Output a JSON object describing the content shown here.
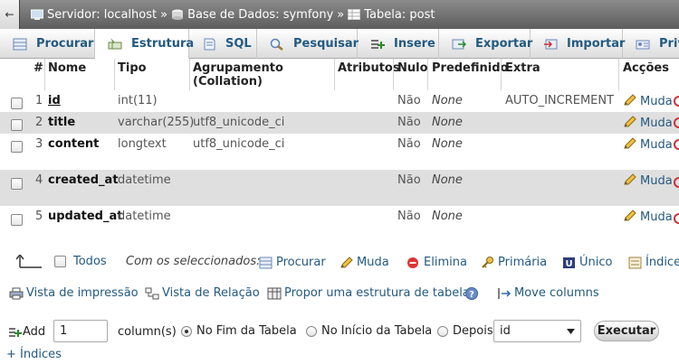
{
  "breadcrumb": {
    "back_glyph": "←",
    "server": "Servidor: localhost",
    "database": "Base de Dados: symfony",
    "table": "Tabela: post",
    "separator": "»"
  },
  "tabs": [
    {
      "label": "Procurar",
      "icon": "browse-icon",
      "active": false
    },
    {
      "label": "Estrutura",
      "icon": "structure-icon",
      "active": true
    },
    {
      "label": "SQL",
      "icon": "sql-icon",
      "active": false
    },
    {
      "label": "Pesquisar",
      "icon": "search-icon",
      "active": false
    },
    {
      "label": "Insere",
      "icon": "insert-icon",
      "active": false
    },
    {
      "label": "Exportar",
      "icon": "export-icon",
      "active": false
    },
    {
      "label": "Importar",
      "icon": "import-icon",
      "active": false
    },
    {
      "label": "Privi",
      "icon": "privileges-icon",
      "active": false
    }
  ],
  "table_headers": {
    "num": "#",
    "name": "Nome",
    "type": "Tipo",
    "collation": "Agrupamento (Collation)",
    "attributes": "Atributos",
    "null": "Nulo",
    "default": "Predefinido",
    "extra": "Extra",
    "actions": "Acções"
  },
  "rows": [
    {
      "num": "1",
      "name": "id",
      "type": "int(11)",
      "collation": "",
      "null": "Não",
      "default": "None",
      "extra": "AUTO_INCREMENT",
      "action": "Muda"
    },
    {
      "num": "2",
      "name": "title",
      "type": "varchar(255)",
      "collation": "utf8_unicode_ci",
      "null": "Não",
      "default": "None",
      "extra": "",
      "action": "Muda"
    },
    {
      "num": "3",
      "name": "content",
      "type": "longtext",
      "collation": "utf8_unicode_ci",
      "null": "Não",
      "default": "None",
      "extra": "",
      "action": "Muda"
    },
    {
      "num": "4",
      "name": "created_at",
      "type": "datetime",
      "collation": "",
      "null": "Não",
      "default": "None",
      "extra": "",
      "action": "Muda"
    },
    {
      "num": "5",
      "name": "updated_at",
      "type": "datetime",
      "collation": "",
      "null": "Não",
      "default": "None",
      "extra": "",
      "action": "Muda"
    }
  ],
  "bulk": {
    "check_all": "Todos",
    "with_selected": "Com os seleccionados:",
    "browse": "Procurar",
    "change": "Muda",
    "drop": "Elimina",
    "primary": "Primária",
    "unique": "Único",
    "index": "Índice"
  },
  "tools": {
    "print_view": "Vista de impressão",
    "relation_view": "Vista de Relação",
    "propose_structure": "Propor uma estrutura de tabela",
    "move_columns": "Move columns"
  },
  "add_columns": {
    "add_label": "Add",
    "count": "1",
    "columns_label": "column(s)",
    "at_end": "No Fim da Tabela",
    "at_start": "No Início da Tabela",
    "after": "Depois",
    "after_column": "id",
    "go": "Executar"
  },
  "indexes_link": "+ Índices",
  "colors": {
    "link": "#235a81",
    "row_alt": "#dfdfdf",
    "topbar": "#6e6e6e"
  }
}
